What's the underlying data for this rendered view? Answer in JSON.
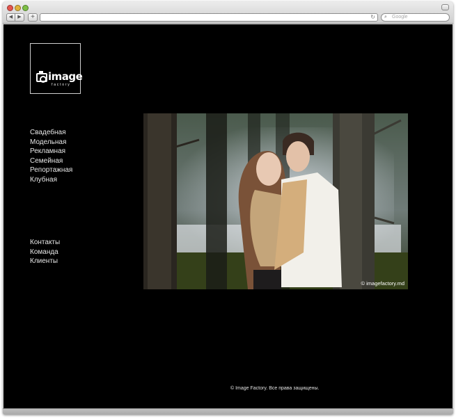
{
  "browser": {
    "search_placeholder": "Google",
    "back_glyph": "◀",
    "forward_glyph": "▶",
    "add_glyph": "+",
    "reload_glyph": "↻",
    "search_glyph": "⌕"
  },
  "site": {
    "logo": {
      "word": "image",
      "sub": "factory"
    },
    "nav_primary": [
      "Свадебная",
      "Модельная",
      "Рекламная",
      "Семейная",
      "Репортажная",
      "Клубная"
    ],
    "nav_secondary": [
      "Контакты",
      "Команда",
      "Клиенты"
    ],
    "photo_watermark": "© imagefactory.md",
    "footer": "© Image Factory. Все права защищены."
  },
  "colors": {
    "page_background": "#000000",
    "menu_text": "#e6e6e6"
  }
}
